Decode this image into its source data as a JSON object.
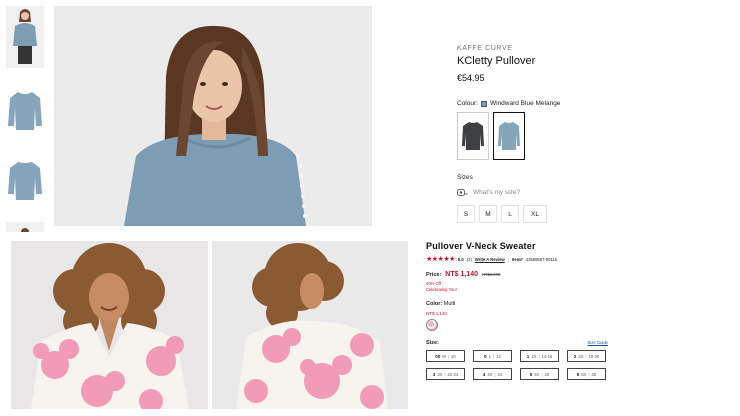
{
  "product1": {
    "brand": "KAFFE CURVE",
    "title": "KCletty Pullover",
    "price": "€54.95",
    "colour_label": "Colour:",
    "colour_value": "Windward Blue Melange",
    "colour_options": [
      "dark-grey",
      "windward-blue-melange"
    ],
    "sizes_label": "Sizes",
    "whats_my_size": "What's my size?",
    "sizes": [
      "S",
      "M",
      "L",
      "XL"
    ],
    "colors": {
      "sweater_blue": "#7d9db4",
      "sweater_dark": "#3d3f42"
    }
  },
  "product2": {
    "title": "Pullover V-Neck Sweater",
    "rating": "5.0",
    "review_count": "(2)",
    "separator": "|",
    "write_review": "Write A Review",
    "item_label": "Item#",
    "item_number": "43565557-00115",
    "price_label": "Price:",
    "price_now": "NT$ 1,140",
    "price_was": "NT$1,900",
    "discount": "40% Off",
    "promo": "Celebrating You!",
    "color_label": "Color:",
    "color_value": "Multi",
    "color_price": "NT$ 1,140",
    "size_label": "Size:",
    "size_guide": "Size Guide",
    "sizes": [
      {
        "num": "00",
        "alpha": "M",
        "range": "10"
      },
      {
        "num": "0",
        "alpha": "L",
        "range": "12"
      },
      {
        "num": "1",
        "alpha": "1X",
        "range": "14-16"
      },
      {
        "num": "2",
        "alpha": "2X",
        "range": "18-20"
      },
      {
        "num": "3",
        "alpha": "3X",
        "range": "22-24"
      },
      {
        "num": "4",
        "alpha": "4X",
        "range": "24"
      },
      {
        "num": "5",
        "alpha": "5X",
        "range": "26"
      },
      {
        "num": "6",
        "alpha": "6X",
        "range": "30"
      }
    ],
    "colors": {
      "accent_red": "#c8102e",
      "floral_pink": "#f29bb8"
    }
  }
}
